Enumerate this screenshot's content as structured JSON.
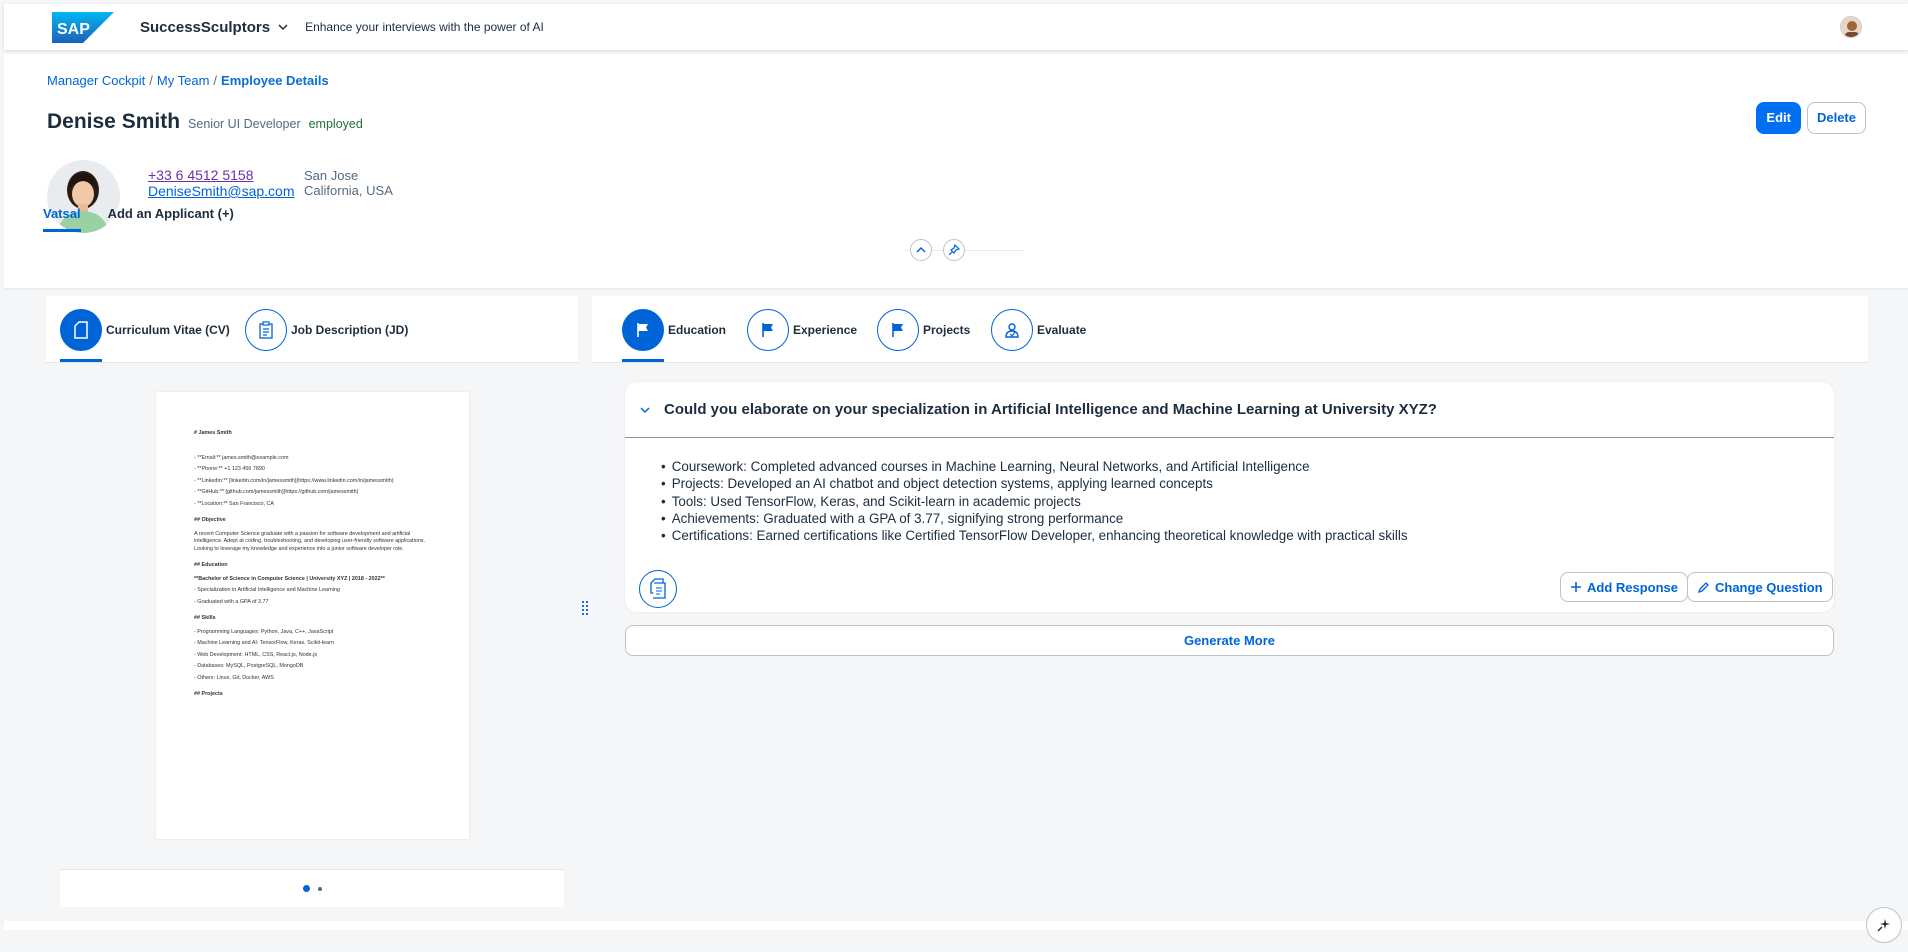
{
  "shell": {
    "product": "SuccessSculptors",
    "tagline": "Enhance your interviews with the power of AI"
  },
  "breadcrumb": [
    "Manager Cockpit",
    "My Team",
    "Employee Details"
  ],
  "employee": {
    "name": "Denise Smith",
    "role": "Senior UI Developer",
    "status": "employed",
    "phone": "+33 6 4512 5158",
    "email": "DeniseSmith@sap.com",
    "city": "San Jose",
    "region": "California, USA"
  },
  "header_actions": {
    "edit": "Edit",
    "delete": "Delete"
  },
  "page_tabs": [
    "Vatsal",
    "Add an Applicant (+)"
  ],
  "left_tabs": [
    "Curriculum Vitae (CV)",
    "Job Description (JD)"
  ],
  "right_tabs": [
    "Education",
    "Experience",
    "Projects",
    "Evaluate"
  ],
  "cv": {
    "heading": "# James Smith",
    "lines": [
      "- **Email:** james.smith@example.com",
      "- **Phone:** +1 123 456 7890",
      "- **LinkedIn:** [linkedin.com/in/jamessmith](https://www.linkedin.com/in/jamessmith)",
      "- **GitHub:** [github.com/jamessmith](https://github.com/jamessmith)",
      "- **Location:** San Francisco, CA"
    ],
    "objective_h": "## Objective",
    "objective": "A recent Computer Science graduate with a passion for software development and artificial intelligence. Adept at coding, troubleshooting, and developing user-friendly software applications. Looking to leverage my knowledge and experience into a junior software developer role.",
    "education_h": "## Education",
    "degree": "**Bachelor of Science in Computer Science | University XYZ | 2018 - 2022**",
    "education": [
      "- Specialization in Artificial Intelligence and Machine Learning",
      "- Graduated with a GPA of 3.77"
    ],
    "skills_h": "## Skills",
    "skills": [
      "- Programming Languages: Python, Java, C++, JavaScript",
      "- Machine Learning and AI: TensorFlow, Keras, Scikit-learn",
      "- Web Development: HTML, CSS, React.js, Node.js",
      "- Databases: MySQL, PostgreSQL, MongoDB",
      "- Others: Linux, Git, Docker, AWS"
    ],
    "projects_h": "## Projects"
  },
  "question_card": {
    "question": "Could you elaborate on your specialization in Artificial Intelligence and Machine Learning at University XYZ?",
    "bullets": [
      "Coursework: Completed advanced courses in Machine Learning, Neural Networks, and Artificial Intelligence",
      "Projects: Developed an AI chatbot and object detection systems, applying learned concepts",
      "Tools: Used TensorFlow, Keras, and Scikit-learn in academic projects",
      "Achievements: Graduated with a GPA of 3.77, signifying strong performance",
      "Certifications: Earned certifications like Certified TensorFlow Developer, enhancing theoretical knowledge with practical skills"
    ],
    "add_response": "Add Response",
    "change_question": "Change Question"
  },
  "generate_more": "Generate More",
  "colors": {
    "accent": "#0064d9",
    "emphasized": "#0070f2",
    "positive": "#256f3a"
  }
}
